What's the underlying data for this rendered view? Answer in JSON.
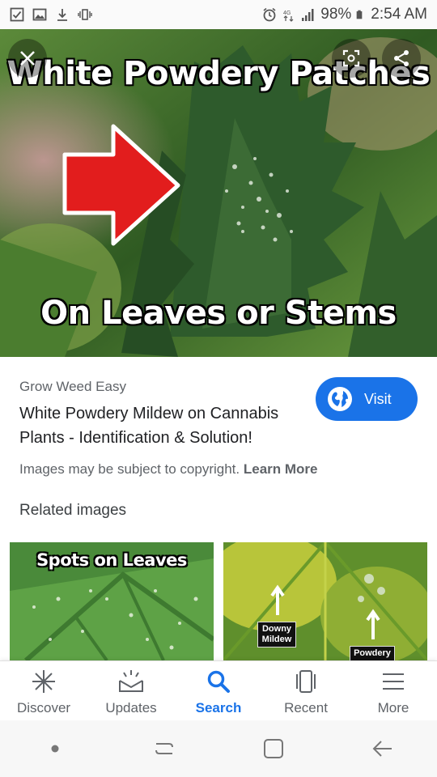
{
  "status_bar": {
    "battery": "98%",
    "time": "2:54 AM",
    "left_icons": [
      "checkbox-icon",
      "image-icon",
      "download-icon",
      "vibrate-icon"
    ],
    "right_icons": [
      "alarm-icon",
      "data-icon",
      "signal-icon",
      "battery-icon"
    ]
  },
  "hero": {
    "caption_top": "White Powdery Patches",
    "caption_bottom": "On Leaves or Stems",
    "close_icon": "close-icon",
    "share_icons": [
      "lens-icon",
      "share-icon"
    ]
  },
  "result": {
    "source": "Grow Weed Easy",
    "title": "White Powdery Mildew on Cannabis Plants - Identification & Solution!",
    "visit_label": "Visit",
    "copyright_text": "Images may be subject to copyright.",
    "learn_more": "Learn More"
  },
  "related": {
    "heading": "Related images",
    "thumbs": [
      {
        "caption": "Spots on Leaves"
      },
      {
        "tags": [
          "Downy Mildew",
          "Powdery"
        ]
      }
    ]
  },
  "bottom_nav": {
    "items": [
      {
        "label": "Discover",
        "icon": "asterisk-icon"
      },
      {
        "label": "Updates",
        "icon": "updates-icon"
      },
      {
        "label": "Search",
        "icon": "search-icon",
        "active": true
      },
      {
        "label": "Recent",
        "icon": "recent-icon"
      },
      {
        "label": "More",
        "icon": "menu-icon"
      }
    ]
  },
  "colors": {
    "accent": "#1a73e8",
    "text_secondary": "#5f6368"
  }
}
